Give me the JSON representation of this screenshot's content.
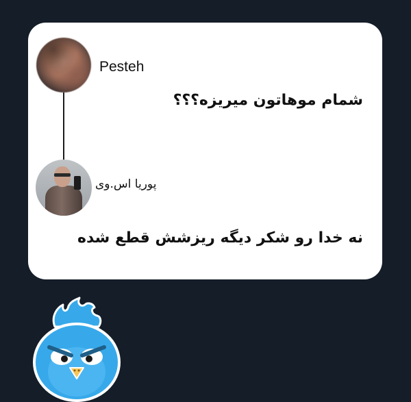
{
  "thread": {
    "post": {
      "author": "Pesteh",
      "text": "شمام موهاتون میریزه؟؟؟",
      "avatar_icon": "user-avatar-photo"
    },
    "reply": {
      "author": "پوریا اس.وی",
      "text": "نه خدا رو شکر دیگه ریزشش قطع شده",
      "avatar_icon": "user-avatar-photo"
    }
  },
  "colors": {
    "background": "#141d28",
    "card": "#ffffff",
    "mascot_blue": "#37a9ea",
    "mascot_beak": "#f6c65a"
  },
  "mascot": {
    "icon": "angry-blue-bird-mascot"
  }
}
